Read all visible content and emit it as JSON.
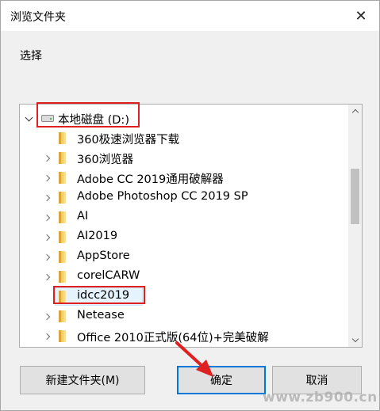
{
  "window": {
    "title": "浏览文件夹",
    "close_glyph": "✕"
  },
  "prompt": "选择",
  "tree": {
    "root": {
      "label": "本地磁盘 (D:)",
      "expanded": true,
      "icon": "drive-icon"
    },
    "items": [
      {
        "label": "360极速浏览器下载",
        "has_children": false
      },
      {
        "label": "360浏览器",
        "has_children": true
      },
      {
        "label": "Adobe CC 2019通用破解器",
        "has_children": true
      },
      {
        "label": "Adobe Photoshop CC 2019 SP",
        "has_children": true
      },
      {
        "label": "AI",
        "has_children": true
      },
      {
        "label": "AI2019",
        "has_children": true
      },
      {
        "label": "AppStore",
        "has_children": true
      },
      {
        "label": "corelCARW",
        "has_children": true
      },
      {
        "label": "idcc2019",
        "has_children": false,
        "selected": true
      },
      {
        "label": "Netease",
        "has_children": true
      },
      {
        "label": "Office 2010正式版(64位)+完美破解",
        "has_children": true
      }
    ]
  },
  "buttons": {
    "new_folder": "新建文件夹(M)",
    "ok": "确定",
    "cancel": "取消"
  },
  "watermark": "www.zb900.cn",
  "colors": {
    "highlight_box": "#e02020",
    "selection": "#e5f3ff",
    "primary_border": "#0078d7",
    "folder": "#f6d36a"
  }
}
